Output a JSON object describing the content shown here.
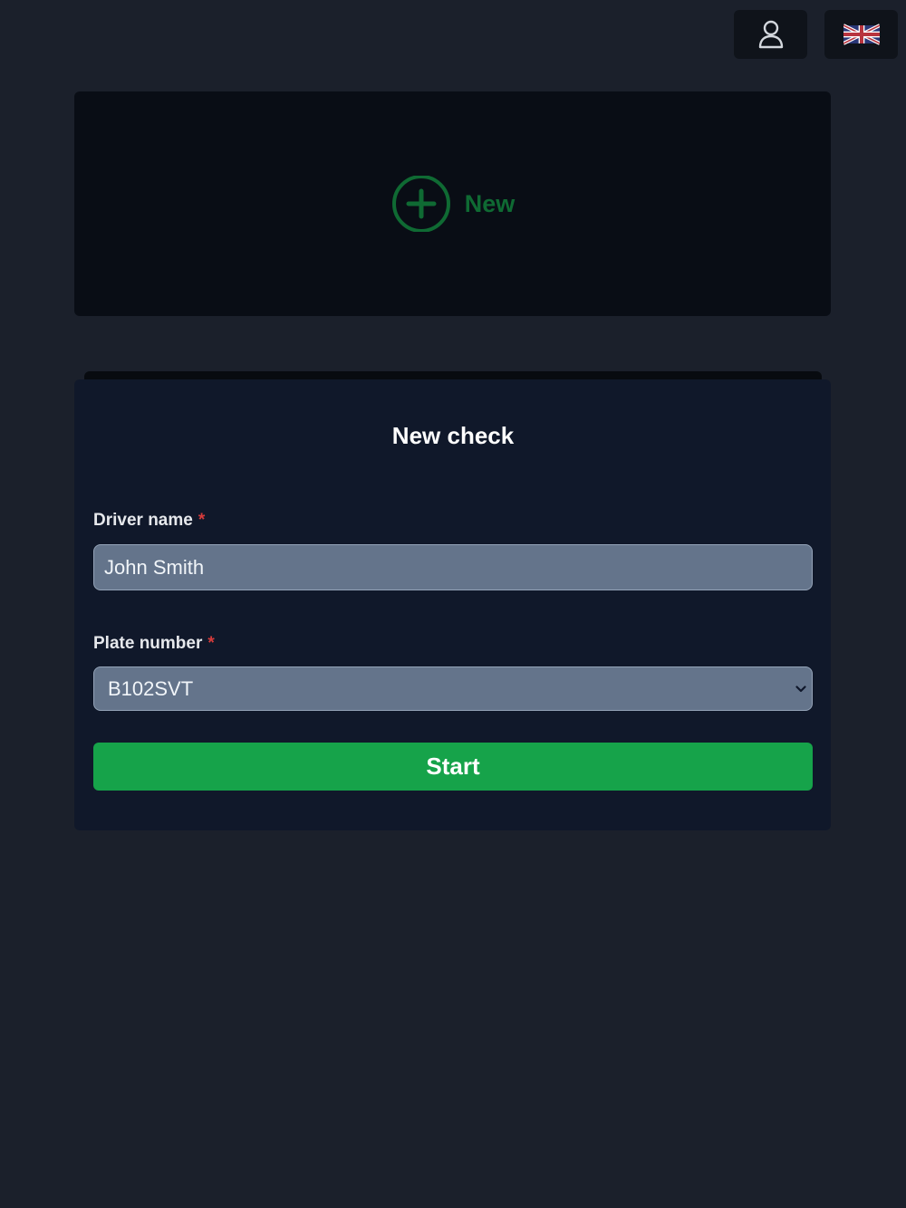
{
  "header": {
    "user_icon": "user-icon",
    "language_icon": "uk-flag-icon"
  },
  "new_card": {
    "label": "New",
    "icon": "plus-circle-icon",
    "accent_color": "#0f6a33"
  },
  "form": {
    "title": "New check",
    "driver_name": {
      "label": "Driver name",
      "required_mark": "*",
      "value": "John Smith"
    },
    "plate_number": {
      "label": "Plate number",
      "required_mark": "*",
      "selected": "B102SVT"
    },
    "submit_label": "Start",
    "submit_color": "#16a34a"
  }
}
